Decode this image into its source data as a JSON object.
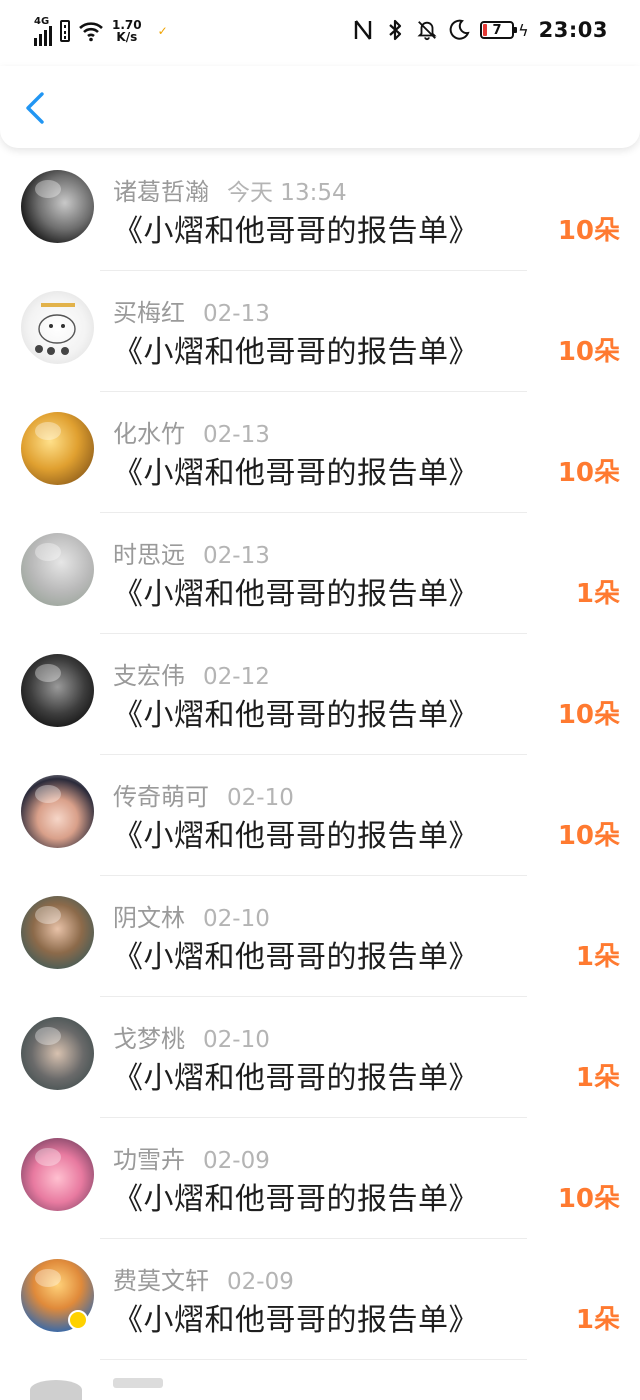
{
  "status_bar": {
    "network": "4G",
    "speed_value": "1.70",
    "speed_unit": "K/s",
    "battery": "7",
    "time": "23:03",
    "icons": [
      "signal-icon",
      "sim-icon",
      "wifi-icon",
      "nfc-icon",
      "bluetooth-icon",
      "mute-icon",
      "moon-icon",
      "battery-icon",
      "charging-icon"
    ]
  },
  "nav": {
    "back_icon": "chevron-left-icon",
    "accent": "#2196f3"
  },
  "colors": {
    "amount": "#ff7a30",
    "title": "#1e1e1e",
    "meta": "#999999"
  },
  "list": [
    {
      "name": "诸葛哲瀚",
      "date": "今天 13:54",
      "title": "《小熠和他哥哥的报告单》",
      "amount": "10朵"
    },
    {
      "name": "买梅红",
      "date": "02-13",
      "title": "《小熠和他哥哥的报告单》",
      "amount": "10朵"
    },
    {
      "name": "化水竹",
      "date": "02-13",
      "title": "《小熠和他哥哥的报告单》",
      "amount": "10朵"
    },
    {
      "name": "时思远",
      "date": "02-13",
      "title": "《小熠和他哥哥的报告单》",
      "amount": "1朵"
    },
    {
      "name": "支宏伟",
      "date": "02-12",
      "title": "《小熠和他哥哥的报告单》",
      "amount": "10朵"
    },
    {
      "name": "传奇萌可",
      "date": "02-10",
      "title": "《小熠和他哥哥的报告单》",
      "amount": "10朵"
    },
    {
      "name": "阴文林",
      "date": "02-10",
      "title": "《小熠和他哥哥的报告单》",
      "amount": "1朵"
    },
    {
      "name": "戈梦桃",
      "date": "02-10",
      "title": "《小熠和他哥哥的报告单》",
      "amount": "1朵"
    },
    {
      "name": "功雪卉",
      "date": "02-09",
      "title": "《小熠和他哥哥的报告单》",
      "amount": "10朵"
    },
    {
      "name": "费莫文轩",
      "date": "02-09",
      "title": "《小熠和他哥哥的报告单》",
      "amount": "1朵"
    }
  ]
}
